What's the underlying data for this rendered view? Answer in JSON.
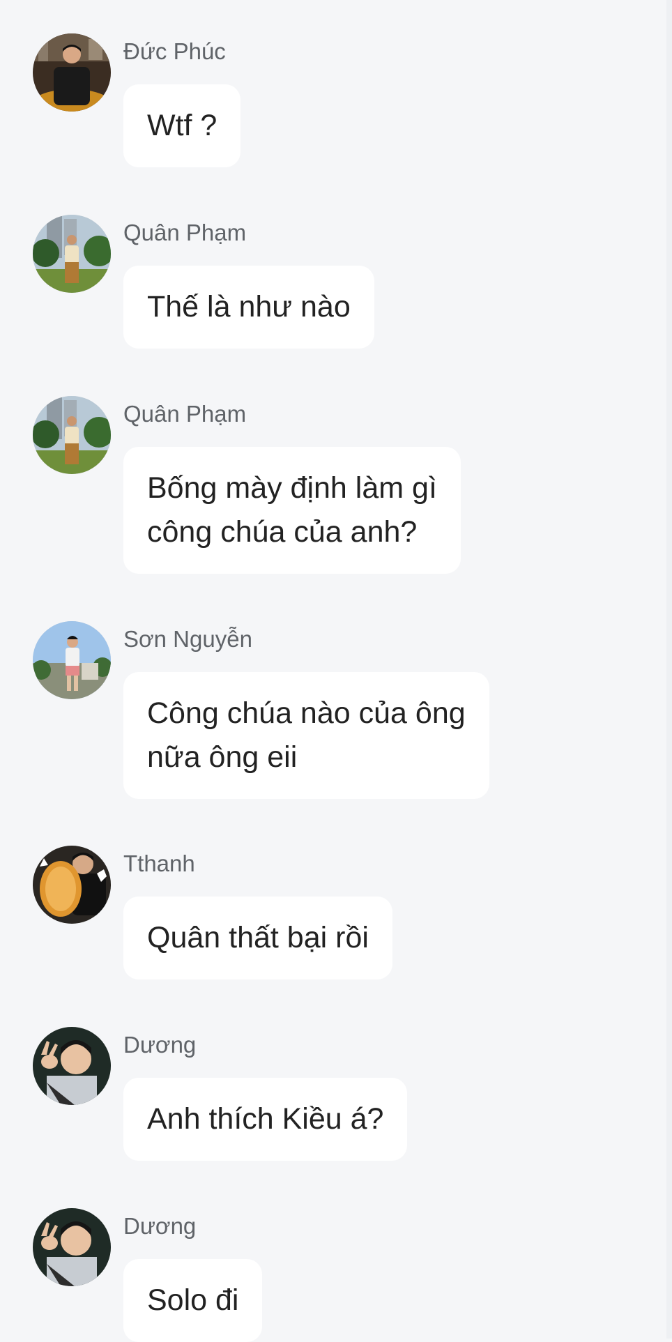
{
  "messages": [
    {
      "sender": "Đức Phúc",
      "text": "Wtf ?",
      "avatar": "duc-phuc-avatar"
    },
    {
      "sender": "Quân Phạm",
      "text": "Thế là như nào",
      "avatar": "quan-pham-avatar"
    },
    {
      "sender": "Quân Phạm",
      "text": "Bống mày định làm gì\ncông chúa của anh?",
      "avatar": "quan-pham-avatar"
    },
    {
      "sender": "Sơn Nguyễn",
      "text": "Công chúa nào của ông\nnữa ông eii",
      "avatar": "son-nguyen-avatar"
    },
    {
      "sender": "Tthanh",
      "text": "Quân thất bại rồi",
      "avatar": "tthanh-avatar"
    },
    {
      "sender": "Dương",
      "text": "Anh thích Kiều á?",
      "avatar": "duong-avatar"
    },
    {
      "sender": "Dương",
      "text": "Solo đi",
      "avatar": "duong-avatar"
    }
  ],
  "colors": {
    "background": "#f5f6f8",
    "bubble": "#ffffff",
    "sender_text": "#5f6368",
    "message_text": "#222222"
  }
}
